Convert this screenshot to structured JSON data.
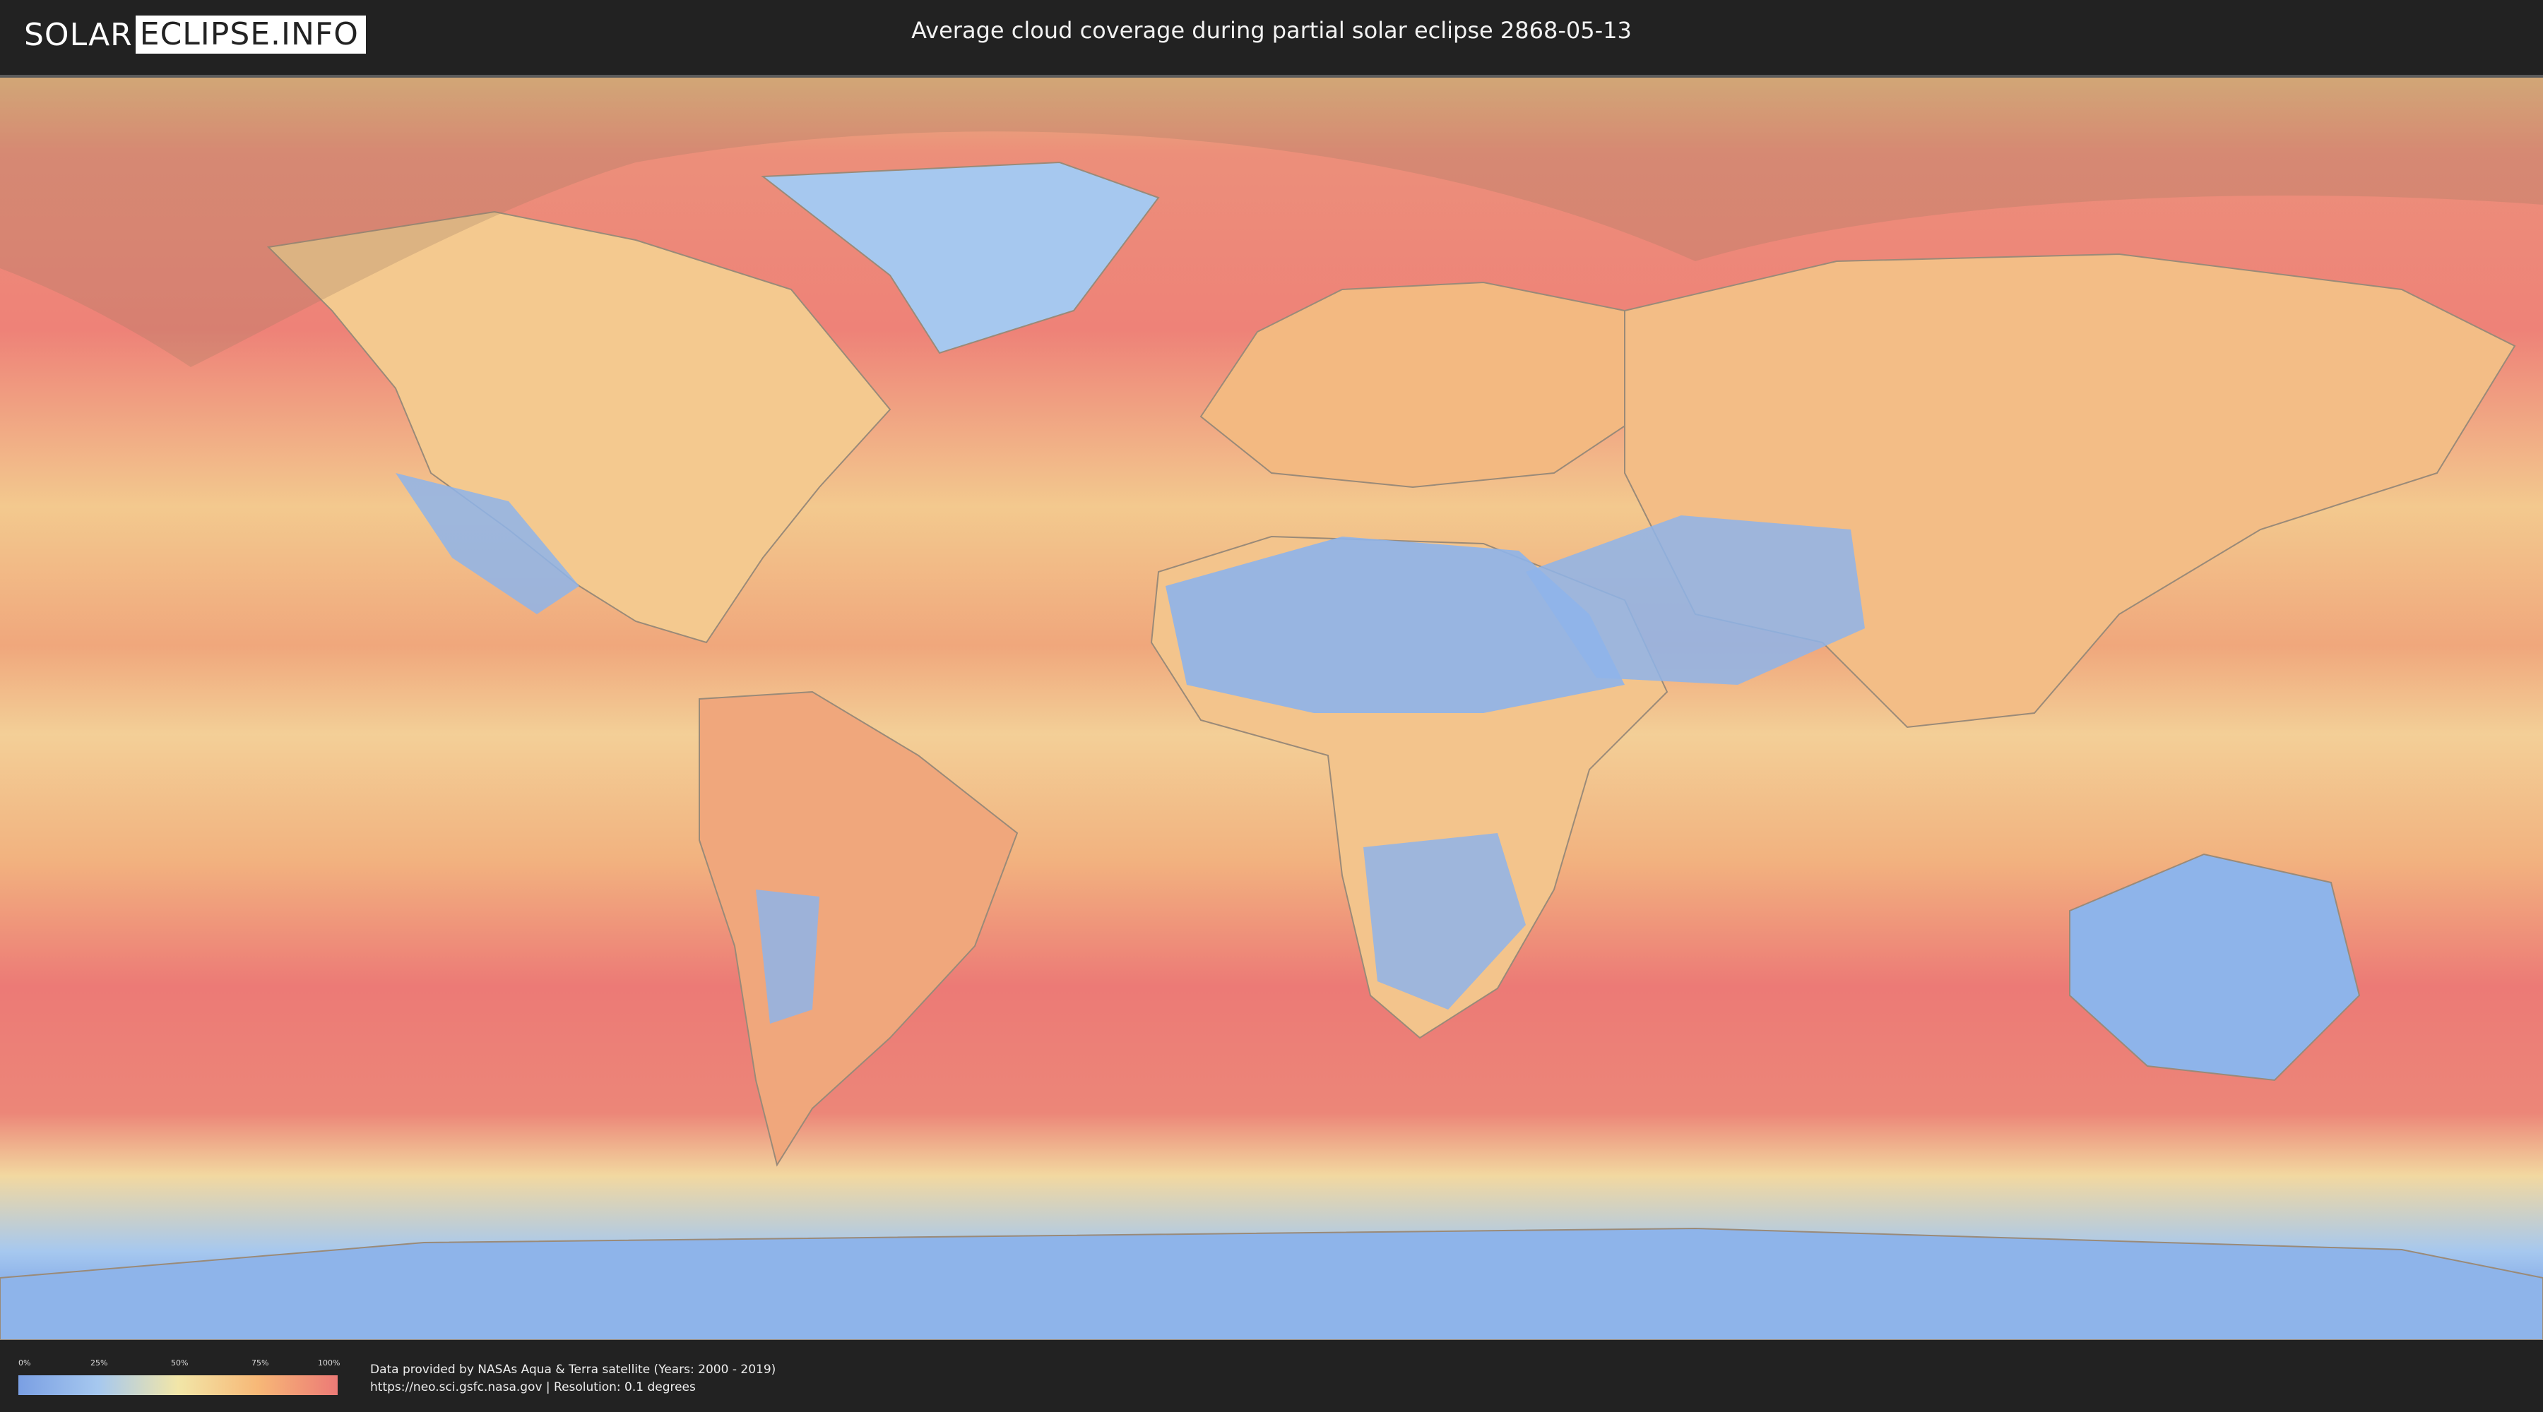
{
  "header": {
    "logo_left": "SOLAR",
    "logo_right": "ECLIPSE.INFO",
    "title": "Average cloud coverage during partial solar eclipse 2868-05-13"
  },
  "legend": {
    "ticks": [
      "0%",
      "25%",
      "50%",
      "75%",
      "100%"
    ],
    "colors": [
      "#7a9fe3",
      "#a6c8ef",
      "#f2e6a8",
      "#f7b877",
      "#ec7a76"
    ]
  },
  "credits": {
    "line1": "Data provided by NASAs Aqua & Terra satellite (Years: 2000 - 2019)",
    "line2": "https://neo.sci.gsfc.nasa.gov | Resolution: 0.1 degrees"
  },
  "map": {
    "ocean_color": "#f2c58a",
    "cloudy_color": "#ec7a76",
    "clear_color": "#8eb4ea",
    "shadow_color": "#9e7a62"
  }
}
